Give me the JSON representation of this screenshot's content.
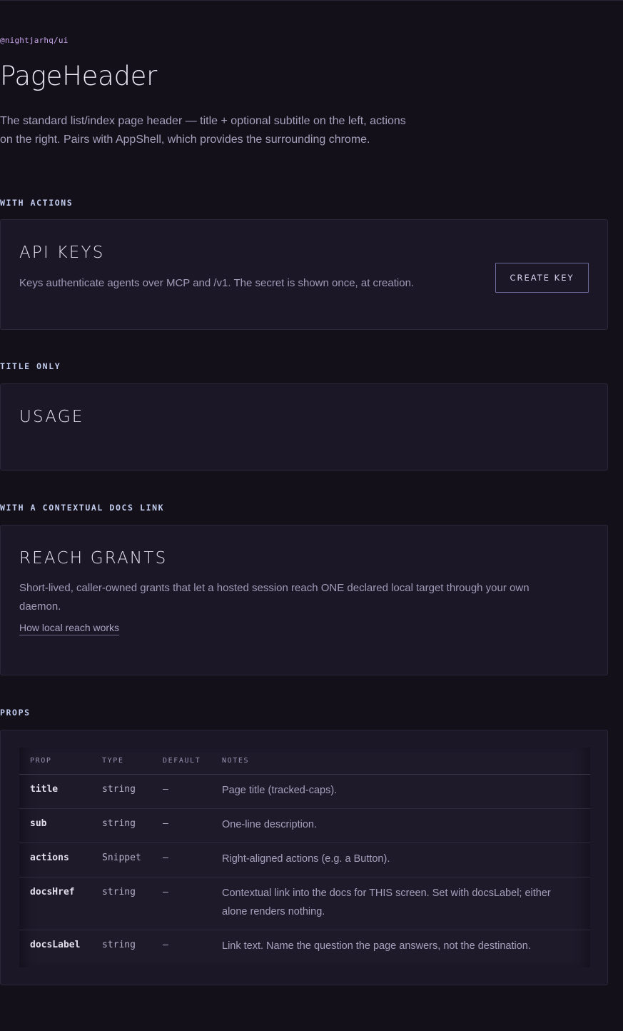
{
  "header": {
    "package": "@nightjarhq/ui",
    "title": "PageHeader",
    "description": "The standard list/index page header — title + optional subtitle on the left, actions on the right. Pairs with AppShell, which provides the surrounding chrome."
  },
  "sections": {
    "with_actions": {
      "label": "WITH ACTIONS",
      "card_title": "API KEYS",
      "card_sub": "Keys authenticate agents over MCP and /v1. The secret is shown once, at creation.",
      "button_label": "CREATE KEY"
    },
    "title_only": {
      "label": "TITLE ONLY",
      "card_title": "USAGE"
    },
    "docs_link": {
      "label": "WITH A CONTEXTUAL DOCS LINK",
      "card_title": "REACH GRANTS",
      "card_sub": "Short-lived, caller-owned grants that let a hosted session reach ONE declared local target through your own daemon.",
      "link_label": "How local reach works"
    },
    "props": {
      "label": "PROPS",
      "columns": [
        "PROP",
        "TYPE",
        "DEFAULT",
        "NOTES"
      ],
      "rows": [
        {
          "prop": "title",
          "type": "string",
          "default": "—",
          "notes": "Page title (tracked-caps)."
        },
        {
          "prop": "sub",
          "type": "string",
          "default": "—",
          "notes": "One-line description."
        },
        {
          "prop": "actions",
          "type": "Snippet",
          "default": "—",
          "notes": "Right-aligned actions (e.g. a Button)."
        },
        {
          "prop": "docsHref",
          "type": "string",
          "default": "—",
          "notes": "Contextual link into the docs for THIS screen. Set with docsLabel; either alone renders nothing."
        },
        {
          "prop": "docsLabel",
          "type": "string",
          "default": "—",
          "notes": "Link text. Name the question the page answers, not the destination."
        }
      ]
    }
  }
}
